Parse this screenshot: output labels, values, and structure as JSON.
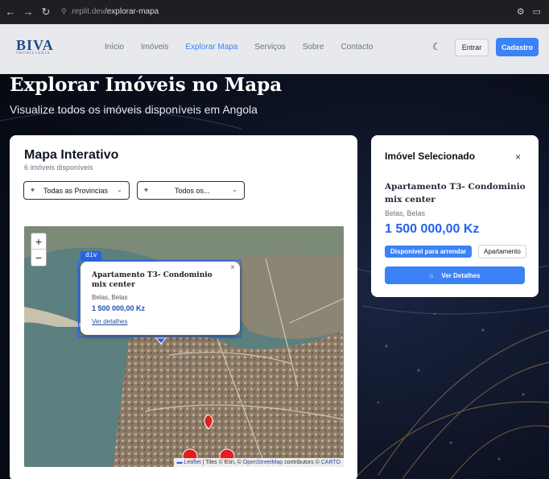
{
  "browser": {
    "url_prefix": ".replit.dev",
    "url_path": "/explorar-mapa"
  },
  "brand": {
    "logo_text": "BIVA",
    "logo_sub": "IMOBILIÁRIA"
  },
  "nav": {
    "items": [
      {
        "label": "Início",
        "active": false
      },
      {
        "label": "Imóveis",
        "active": false
      },
      {
        "label": "Explorar Mapa",
        "active": true
      },
      {
        "label": "Serviços",
        "active": false
      },
      {
        "label": "Sobre",
        "active": false
      },
      {
        "label": "Contacto",
        "active": false
      }
    ],
    "login_label": "Entrar",
    "signup_label": "Cadastro"
  },
  "hero": {
    "title": "Explorar Imóveis no Mapa",
    "subtitle": "Visualize todos os imóveis disponíveis em Angola"
  },
  "map_card": {
    "title": "Mapa Interativo",
    "count": "6 imóveis disponíveis",
    "province_select": "Todas as Provincias",
    "type_select": "Todos os...",
    "zoom_in": "+",
    "zoom_out": "−",
    "inspector_tag": "div",
    "attribution": {
      "leaflet": "Leaflet",
      "tiles": " | Tiles © Esri, © ",
      "osm": "OpenStreetMap",
      "contrib": " contributors © ",
      "carto": "CARTO"
    },
    "popup": {
      "title": "Apartamento T3- Condominio mix center",
      "location": "Belas, Belas",
      "price": "1 500 000,00 Kz",
      "link": "Ver detalhes",
      "close": "×"
    }
  },
  "selected": {
    "heading": "Imóvel Selecionado",
    "close": "×",
    "name": "Apartamento T3- Condominio mix center",
    "location": "Belas, Belas",
    "price": "1 500 000,00 Kz",
    "badge_status": "Disponível para arrendar",
    "badge_type": "Apartamento",
    "details_button": "Ver Detalhes"
  },
  "colors": {
    "accent": "#3b82f6",
    "price": "#2563eb",
    "marker": "#e11d1d"
  }
}
